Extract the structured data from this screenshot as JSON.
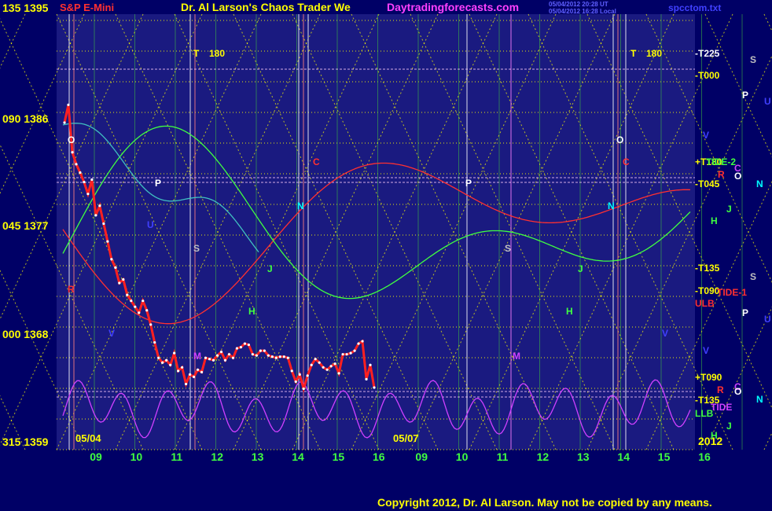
{
  "header": {
    "symbol": "S&P E-Mini",
    "title": "Dr. Al Larson's Chaos Trader We",
    "site": "Daytradingforecasts.com",
    "timestamp_1": "05/04/2012 20:28 UT",
    "timestamp_2": "05/04/2012 16:28 Local",
    "file": "spcctom.txt"
  },
  "footer": {
    "copyright": "Copyright 2012, Dr. Al Larson. May not be copied by any means."
  },
  "colors": {
    "background": "#000066",
    "plot_bg": "#1a1a80",
    "grid": "#ffff00",
    "price": "#ff2020",
    "overlay_red": "#ff3030",
    "overlay_green": "#40ff40",
    "overlay_cyan": "#40c0c0",
    "overlay_magenta": "#d040ff"
  },
  "chart_data": {
    "type": "line",
    "title": "S&P E-Mini",
    "y_axis_labels": [
      {
        "angle": "135",
        "price": "1395",
        "value": 1395
      },
      {
        "angle": "090",
        "price": "1386",
        "value": 1386
      },
      {
        "angle": "045",
        "price": "1377",
        "value": 1377
      },
      {
        "angle": "000",
        "price": "1368",
        "value": 1368
      },
      {
        "angle": "315",
        "price": "1359",
        "value": 1359
      }
    ],
    "ylim": [
      1359,
      1395
    ],
    "x_tick_labels": [
      "09",
      "10",
      "11",
      "12",
      "13",
      "14",
      "15",
      "16",
      "09",
      "10",
      "11",
      "12",
      "13",
      "14",
      "15",
      "16"
    ],
    "dates": [
      "05/04",
      "05/07"
    ],
    "year": "2012",
    "session_end_index": 7.9,
    "price_series": {
      "name": "S&P E-Mini",
      "x": [
        0.0,
        0.1,
        0.2,
        0.3,
        0.4,
        0.5,
        0.6,
        0.7,
        0.8,
        0.9,
        1.0,
        1.1,
        1.2,
        1.3,
        1.4,
        1.5,
        1.6,
        1.7,
        1.8,
        1.9,
        2.0,
        2.1,
        2.2,
        2.3,
        2.4,
        2.5,
        2.6,
        2.7,
        2.8,
        2.9,
        3.0,
        3.1,
        3.2,
        3.3,
        3.4,
        3.5,
        3.6,
        3.7,
        3.8,
        3.9,
        4.0,
        4.1,
        4.2,
        4.3,
        4.4,
        4.5,
        4.6,
        4.7,
        4.8,
        4.9,
        5.0,
        5.1,
        5.2,
        5.3,
        5.4,
        5.5,
        5.6,
        5.7,
        5.8,
        5.9,
        6.0,
        6.1,
        6.2,
        6.3,
        6.4,
        6.5,
        6.6,
        6.7,
        6.8,
        6.9,
        7.0,
        7.1,
        7.2,
        7.3,
        7.4,
        7.5,
        7.6,
        7.7,
        7.8,
        7.9
      ],
      "y": [
        1386.0,
        1387.5,
        1383.5,
        1382.5,
        1381.8,
        1381.0,
        1380.0,
        1381.2,
        1378.2,
        1379.0,
        1377.5,
        1376.0,
        1374.5,
        1373.8,
        1372.5,
        1372.8,
        1371.5,
        1371.0,
        1370.5,
        1370.0,
        1371.0,
        1370.2,
        1369.0,
        1367.5,
        1366.2,
        1365.8,
        1366.0,
        1365.6,
        1366.6,
        1365.1,
        1365.4,
        1364.0,
        1364.8,
        1364.6,
        1365.2,
        1365.0,
        1366.2,
        1366.1,
        1366.0,
        1366.4,
        1366.7,
        1366.0,
        1366.5,
        1366.2,
        1367.0,
        1367.1,
        1367.4,
        1367.3,
        1366.5,
        1366.4,
        1366.8,
        1366.8,
        1366.4,
        1366.3,
        1366.2,
        1366.3,
        1366.3,
        1366.2,
        1365.1,
        1364.2,
        1364.8,
        1363.6,
        1364.7,
        1365.6,
        1366.1,
        1365.8,
        1365.4,
        1365.2,
        1365.5,
        1365.7,
        1364.9,
        1366.5,
        1366.5,
        1366.6,
        1366.8,
        1367.4,
        1367.6,
        1364.4,
        1365.6,
        1363.7
      ]
    },
    "annotations_left": [
      {
        "text": "T",
        "color": "#ffff00"
      },
      {
        "text": "180",
        "color": "#ffff00"
      },
      {
        "text": "O",
        "color": "#ffffff"
      },
      {
        "text": "C",
        "color": "#ff3030"
      },
      {
        "text": "P",
        "color": "#ffffff"
      },
      {
        "text": "N",
        "color": "#00ffff"
      },
      {
        "text": "S",
        "color": "#c0c0c0"
      },
      {
        "text": "J",
        "color": "#40ff40"
      },
      {
        "text": "H",
        "color": "#40ff40"
      },
      {
        "text": "U",
        "color": "#4040ff"
      },
      {
        "text": "V",
        "color": "#4040ff"
      },
      {
        "text": "M",
        "color": "#d040ff"
      },
      {
        "text": "R",
        "color": "#ff3030"
      }
    ],
    "annotations_right": [
      {
        "text": "T",
        "color": "#ffff00"
      },
      {
        "text": "180",
        "color": "#ffff00"
      },
      {
        "text": "O",
        "color": "#ffffff"
      },
      {
        "text": "C",
        "color": "#ff3030"
      },
      {
        "text": "P",
        "color": "#ffffff"
      },
      {
        "text": "N",
        "color": "#00ffff"
      },
      {
        "text": "S",
        "color": "#c0c0c0"
      },
      {
        "text": "J",
        "color": "#40ff40"
      },
      {
        "text": "H",
        "color": "#40ff40"
      },
      {
        "text": "M",
        "color": "#d040ff"
      },
      {
        "text": "V",
        "color": "#4040ff"
      }
    ],
    "side_labels": [
      {
        "text": "-T225",
        "color": "#ffffff"
      },
      {
        "text": "-T000",
        "color": "#ffff00"
      },
      {
        "text": "V",
        "color": "#4040ff"
      },
      {
        "text": "+T180",
        "color": "#ffff00"
      },
      {
        "text": "TIDE-2",
        "color": "#40ff40"
      },
      {
        "text": "R",
        "color": "#ff3030"
      },
      {
        "text": "-T045",
        "color": "#ffff00"
      },
      {
        "text": "-T135",
        "color": "#ffff00"
      },
      {
        "text": "-T090",
        "color": "#ffff00"
      },
      {
        "text": "TIDE-1",
        "color": "#ff3030"
      },
      {
        "text": "ULB",
        "color": "#ff3030"
      },
      {
        "text": "+T090",
        "color": "#ffff00"
      },
      {
        "text": "R",
        "color": "#ff3030"
      },
      {
        "text": "-T135",
        "color": "#ffff00"
      },
      {
        "text": "TIDE",
        "color": "#d040ff"
      },
      {
        "text": "LLB",
        "color": "#40ff40"
      }
    ],
    "far_right": [
      {
        "text": "S",
        "color": "#c0c0c0"
      },
      {
        "text": "P",
        "color": "#ffffff"
      },
      {
        "text": "U",
        "color": "#4040ff"
      },
      {
        "text": "C",
        "color": "#d040ff"
      },
      {
        "text": "O",
        "color": "#ffffff"
      },
      {
        "text": "N",
        "color": "#00ffff"
      },
      {
        "text": "J",
        "color": "#40ff40"
      },
      {
        "text": "H",
        "color": "#40ff40"
      },
      {
        "text": "S",
        "color": "#c0c0c0"
      },
      {
        "text": "P",
        "color": "#ffffff"
      },
      {
        "text": "U",
        "color": "#4040ff"
      },
      {
        "text": "V",
        "color": "#4040ff"
      },
      {
        "text": "C",
        "color": "#d040ff"
      },
      {
        "text": "O",
        "color": "#ffffff"
      },
      {
        "text": "N",
        "color": "#00ffff"
      },
      {
        "text": "J",
        "color": "#40ff40"
      },
      {
        "text": "H",
        "color": "#40ff40"
      }
    ],
    "grid": true
  }
}
